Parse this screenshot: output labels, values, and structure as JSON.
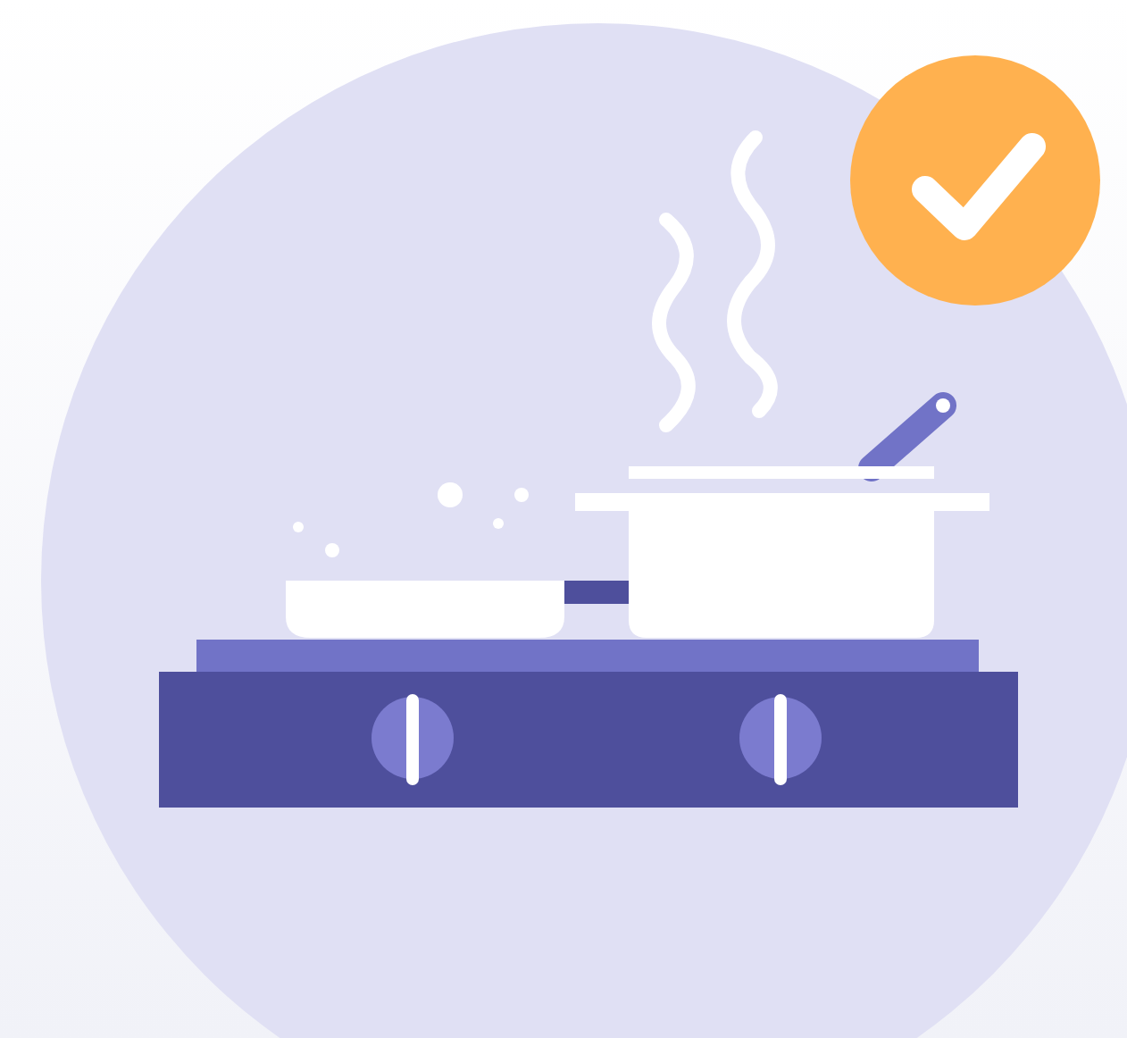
{
  "badge": {
    "checked": true
  }
}
